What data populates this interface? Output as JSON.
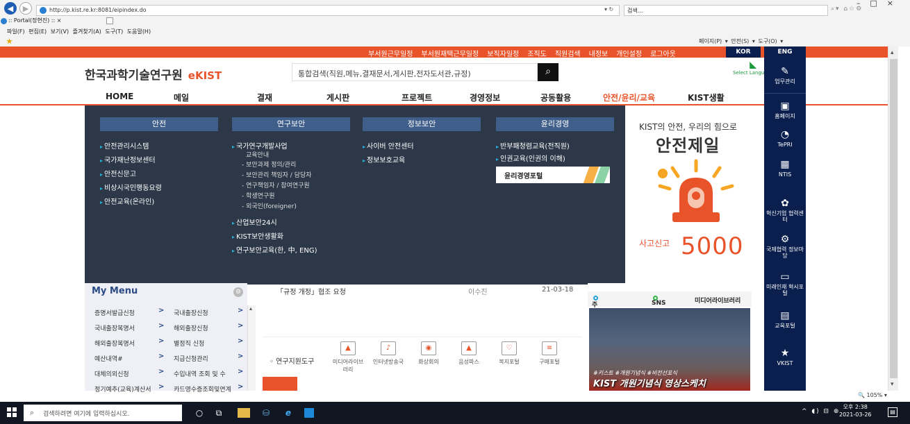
{
  "browser": {
    "url": "http://p.kist.re.kr:8081/eipindex.do",
    "search_placeholder": "검색...",
    "tab_title": ":: Portal(정현진) ::",
    "menu": "파일(F)  편집(E)  보기(V)  즐겨찾기(A)  도구(T)  도움말(H)",
    "command_bar": "페이지(P) ▾  안전(S) ▾  도구(O) ▾",
    "zoom": "105%"
  },
  "topbar": {
    "links": [
      "부서원근무일정",
      "부서원재택근무일정",
      "보직자일정",
      "조직도",
      "직원검색",
      "내정보",
      "개인설정",
      "로그아웃"
    ],
    "lang_kor": "KOR",
    "lang_eng": "ENG"
  },
  "header": {
    "logo": "한국과학기술연구원",
    "logo_sub": "eKIST",
    "search_placeholder": "통합검색(직원,메뉴,결재문서,게시판,전자도서관,규정)",
    "select_language": "Select Language"
  },
  "gnb": [
    "HOME",
    "메일",
    "결재",
    "게시판",
    "프로젝트",
    "경영정보",
    "공동활용",
    "안전/윤리/교육",
    "KIST생활"
  ],
  "mega": {
    "col1": {
      "head": "안전",
      "items": [
        "안전관리시스템",
        "국가재난정보센터",
        "안전신문고",
        "비상시국민행동요령",
        "안전교육(온라인)"
      ]
    },
    "col2": {
      "head": "연구보안",
      "items": [
        "국가연구개발사업",
        "산업보안24시",
        "KIST보안생활화",
        "연구보안교육(한, 中, ENG)"
      ],
      "subs": [
        "교육안내",
        "- 보안과제 정의/관리",
        "- 보안관리 책임자 / 담당자",
        "- 연구책임자 / 참여연구원",
        "- 학생연구원",
        "- 외국인(foreigner)"
      ]
    },
    "col3": {
      "head": "정보보안",
      "items": [
        "사이버 안전센터",
        "정보보호교육"
      ]
    },
    "col4": {
      "head": "윤리경영",
      "items": [
        "반부패청렴교육(전직원)",
        "인권교육(인권의 이해)"
      ],
      "button": "윤리경영포털"
    },
    "promo": {
      "line1": "KIST의 안전, 우리의 힘으로",
      "line2": "안전제일",
      "report": "사고신고",
      "number": "5000"
    }
  },
  "quick": {
    "task": "업무관리",
    "items": [
      "홈페이지",
      "TePRI",
      "NTIS",
      "혁신기업 협력센터",
      "국제협력 정보마당",
      "미래인재 혁시포털",
      "교육포털",
      "VKIST"
    ]
  },
  "mymenu": {
    "title": "My Menu",
    "left": [
      "증명서발급신청",
      "국내출장복명서",
      "해외출장복명서",
      "예산내역#",
      "대체의외신청",
      "정기예추(교육)계산서"
    ],
    "right": [
      "국내출장신청",
      "해외출장신청",
      "별정직 신청",
      "지급신청관리",
      "수입내역 조회 및 수",
      "카드영수증조회및연계"
    ]
  },
  "notice": {
    "title": "「규정 개정」협조 요청",
    "author": "이수진",
    "date": "21-03-18"
  },
  "tools": {
    "label": "연구지원도구",
    "items": [
      "미디어라이브러리",
      "인터넷방송국",
      "화상회의",
      "음성파스",
      "복지포털",
      "구매포털"
    ]
  },
  "news": {
    "tabs": [
      "주요소식",
      "SNS",
      "미디어라이브러리"
    ],
    "caption": "KIST 개원기념식 영상스케치",
    "caption_sub": "#키스트 #개원기념식 #비전선포식"
  },
  "taskbar": {
    "search_placeholder": "검색하려면 여기에 입력하십시오.",
    "time": "오후 2:38",
    "date": "2021-03-26"
  }
}
